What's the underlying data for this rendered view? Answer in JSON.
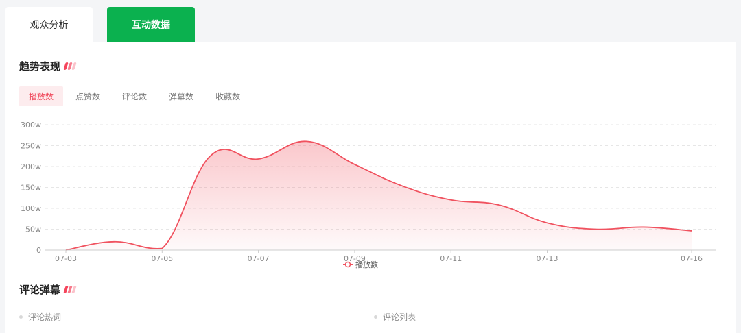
{
  "tabs": [
    {
      "label": "观众分析",
      "active": false
    },
    {
      "label": "互动数据",
      "active": true
    }
  ],
  "trend": {
    "title": "趋势表现",
    "metrics": [
      "播放数",
      "点赞数",
      "评论数",
      "弹幕数",
      "收藏数"
    ],
    "active_metric": "播放数"
  },
  "comments": {
    "title": "评论弹幕",
    "items": [
      "评论热词",
      "评论列表"
    ]
  },
  "colors": {
    "accent_green": "#0bb14f",
    "series_red": "#f0525f",
    "active_metric_bg": "#fdecee"
  },
  "chart_data": {
    "type": "area",
    "x": [
      "07-03",
      "07-04",
      "07-05",
      "07-06",
      "07-07",
      "07-08",
      "07-09",
      "07-10",
      "07-11",
      "07-12",
      "07-13",
      "07-14",
      "07-15",
      "07-16"
    ],
    "x_tick_labels": [
      "07-03",
      "07-05",
      "07-07",
      "07-09",
      "07-11",
      "07-13",
      "07-16"
    ],
    "series": [
      {
        "name": "播放数",
        "values": [
          0,
          20,
          4,
          225,
          218,
          260,
          205,
          153,
          120,
          108,
          65,
          50,
          55,
          46
        ]
      }
    ],
    "y_tick_labels": [
      "0",
      "50w",
      "100w",
      "150w",
      "200w",
      "250w",
      "300w"
    ],
    "ylim": [
      0,
      300
    ],
    "grid": true,
    "legend": "bottom-center"
  }
}
